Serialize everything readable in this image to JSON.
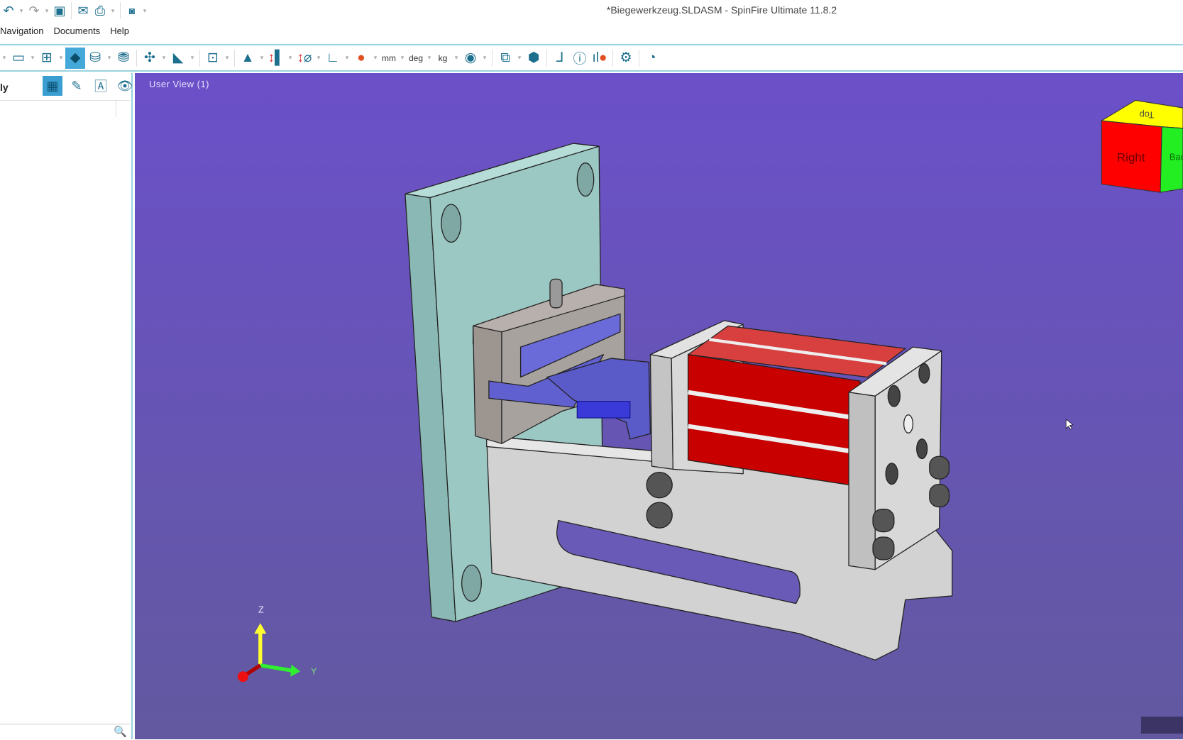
{
  "window": {
    "title": "*Biegewerkzeug.SLDASM - SpinFire Ultimate 11.8.2"
  },
  "quick_access": [
    {
      "icon": "undo-icon",
      "glyph": "↶"
    },
    {
      "icon": "redo-icon",
      "glyph": "↷"
    },
    {
      "icon": "save-icon",
      "glyph": "💾"
    },
    {
      "icon": "email-icon",
      "glyph": "✉"
    },
    {
      "icon": "print-icon",
      "glyph": "🖶"
    },
    {
      "icon": "camera-icon",
      "glyph": "📷"
    }
  ],
  "menu": [
    "Navigation",
    "Documents",
    "Help"
  ],
  "toolbar": {
    "units": {
      "length": "mm",
      "angle": "deg",
      "mass": "kg"
    },
    "icons": [
      "display-icon",
      "layout-icon",
      "shaded-view-icon",
      "cylinder-icon",
      "settings-cylinder-icon",
      "explode-icon",
      "section-icon",
      "annotation-icon",
      "xyz-point-icon",
      "measure-distance-icon",
      "measure-diameter-icon",
      "measure-angle-icon",
      "measure-wall-icon",
      "color-legend-icon",
      "compare-icon",
      "cube-parts-icon",
      "add-axis-icon",
      "info-icon",
      "statistics-icon",
      "gear-icon",
      "performance-icon"
    ]
  },
  "left_panel": {
    "title": "ly",
    "icons": [
      "grid-view-icon",
      "edit-icon",
      "markup-icon",
      "visibility-icon"
    ],
    "search_icon": "search-icon"
  },
  "viewport": {
    "view_label": "User View (1)",
    "background_top": "#6b50c9",
    "background_bottom": "#6259a0",
    "view_cube": {
      "front": "Right",
      "side": "Back",
      "top": "Top"
    },
    "triad": {
      "z": "Z",
      "y": "Y"
    }
  },
  "colors": {
    "accent": "#1d6f8e",
    "cylinder": "#c80000",
    "plate": "#9cc8c4"
  }
}
